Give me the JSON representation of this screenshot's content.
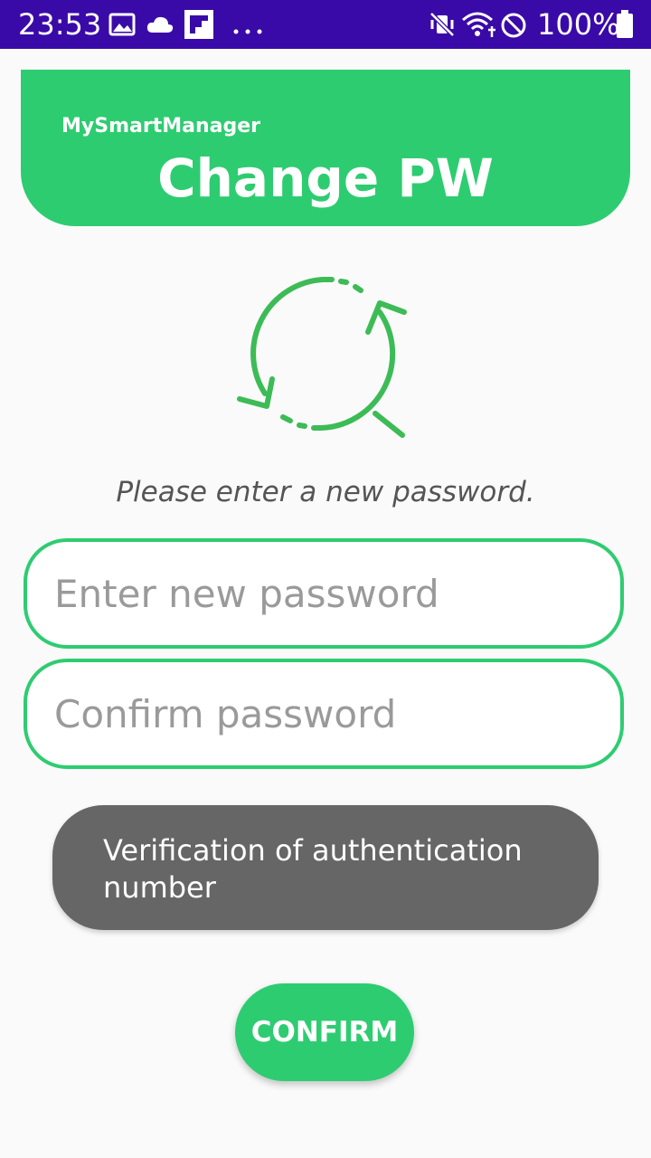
{
  "status_bar": {
    "time": "23:53",
    "battery": "100%",
    "background_color": "#3a0aa8",
    "left_icons": [
      "image-icon",
      "cloud-icon",
      "flipboard-icon",
      "more-dots-icon"
    ],
    "right_icons": [
      "vibrate-mute-icon",
      "wifi-icon",
      "do-not-disturb-icon",
      "battery-icon"
    ]
  },
  "header": {
    "app_name": "MySmartManager",
    "title": "Change PW",
    "background_color": "#2ecc71"
  },
  "illustration": {
    "icon": "password-refresh-icon",
    "color": "#3dbb56"
  },
  "instruction": "Please enter a new password.",
  "fields": {
    "new_password_placeholder": "Enter new password",
    "confirm_password_placeholder": "Confirm password",
    "border_color": "#2ecc71"
  },
  "verification": {
    "label": "Verification of authentication number",
    "background_color": "#666666"
  },
  "confirm_button": {
    "label": "CONFIRM",
    "background_color": "#2ecc71"
  }
}
